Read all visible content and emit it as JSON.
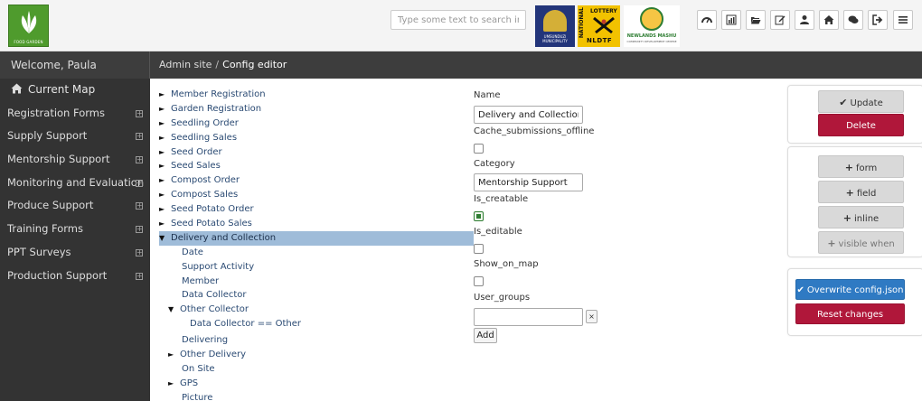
{
  "header": {
    "logo_text": "FOOD GARDEN",
    "search_placeholder": "Type some text to search in th",
    "partners": [
      {
        "name": "uMsunduzi logo",
        "label": "UMSUNDUZI MUNICIPALITY"
      },
      {
        "name": "lottery logo",
        "side": "NATIONAL",
        "top": "LOTTERY",
        "label": "NLDTF"
      },
      {
        "name": "newlands mashu logo",
        "label": "NEWLANDS MASHU",
        "sub": "COMMUNITY DEVELOPMENT CENTRE"
      }
    ],
    "toolbar_icons": [
      "dashboard-icon",
      "bar-chart-icon",
      "folder-open-icon",
      "edit-icon",
      "user-icon",
      "home-icon",
      "comments-icon",
      "sign-out-icon",
      "menu-icon"
    ]
  },
  "welcome": "Welcome,  Paula",
  "breadcrumb": {
    "root": "Admin site",
    "sep": "/",
    "current": "Config editor"
  },
  "sidebar": {
    "home": "Current Map",
    "items": [
      "Registration Forms",
      "Supply Support",
      "Mentorship Support",
      "Monitoring and Evaluation",
      "Produce Support",
      "Training Forms",
      "PPT Surveys",
      "Production Support"
    ]
  },
  "tree": {
    "forms": [
      "Member Registration",
      "Garden Registration",
      "Seedling Order",
      "Seedling Sales",
      "Seed Order",
      "Seed Sales",
      "Compost Order",
      "Compost Sales",
      "Seed Potato Order",
      "Seed Potato Sales"
    ],
    "selected": "Delivery and Collection",
    "fields_a": [
      "Date",
      "Support Activity",
      "Member",
      "Data Collector"
    ],
    "group1": "Other Collector",
    "group1_child": "Data Collector == Other",
    "fields_b": [
      "Delivering"
    ],
    "group2": "Other Delivery",
    "fields_c": [
      "On Site"
    ],
    "group3": "GPS",
    "fields_d": [
      "Picture"
    ]
  },
  "form": {
    "name_label": "Name",
    "name_value": "Delivery and Collection",
    "cache_label": "Cache_submissions_offline",
    "category_label": "Category",
    "category_value": "Mentorship Support",
    "creatable_label": "Is_creatable",
    "editable_label": "Is_editable",
    "show_map_label": "Show_on_map",
    "user_groups_label": "User_groups",
    "remove_label": "×",
    "add_label": "Add"
  },
  "actions": {
    "update": "Update",
    "delete": "Delete",
    "form": "form",
    "field": "field",
    "inline": "inline",
    "visible_when": "visible when",
    "overwrite": "Overwrite config.json",
    "reset": "Reset changes"
  },
  "colors": {
    "accent_red": "#b0173a",
    "accent_blue": "#2f7ac3",
    "selection": "#9fbcd9",
    "sidebar": "#333333"
  }
}
